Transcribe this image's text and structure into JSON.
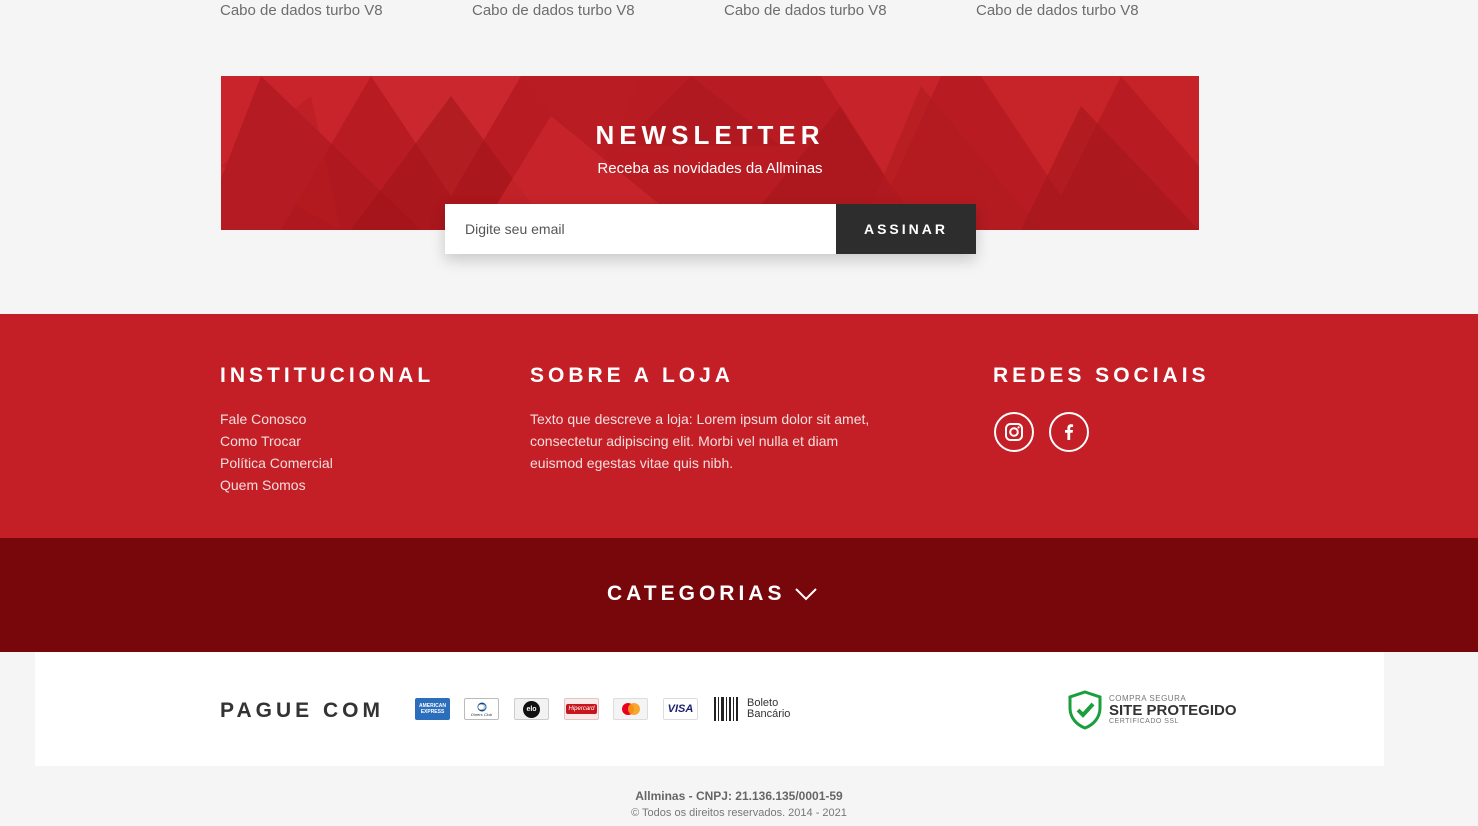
{
  "products": {
    "items": [
      {
        "name": "Cabo de dados turbo V8"
      },
      {
        "name": "Cabo de dados turbo V8"
      },
      {
        "name": "Cabo de dados turbo V8"
      },
      {
        "name": "Cabo de dados turbo V8"
      }
    ]
  },
  "newsletter": {
    "title": "NEWSLETTER",
    "subtitle": "Receba as novidades da Allminas",
    "placeholder": "Digite seu email",
    "button_label": "ASSINAR"
  },
  "footer": {
    "institucional": {
      "title": "INSTITUCIONAL",
      "links": [
        "Fale Conosco",
        "Como Trocar",
        "Política Comercial",
        "Quem Somos"
      ]
    },
    "sobre": {
      "title": "SOBRE A LOJA",
      "text": "Texto que descreve a loja: Lorem ipsum dolor sit amet, consectetur adipiscing elit. Morbi vel nulla et diam euismod egestas vitae quis nibh."
    },
    "redes": {
      "title": "REDES SOCIAIS",
      "icons": [
        "instagram-icon",
        "facebook-icon"
      ]
    }
  },
  "categories": {
    "label": "CATEGORIAS",
    "icon": "chevron-down-icon"
  },
  "payment": {
    "title": "PAGUE COM",
    "cards": [
      {
        "name": "amex-card-icon",
        "label": "AMERICAN EXPRESS"
      },
      {
        "name": "diners-club-card-icon",
        "label": "Diners Club"
      },
      {
        "name": "elo-card-icon",
        "label": "elo"
      },
      {
        "name": "hipercard-card-icon",
        "label": "Hipercard"
      },
      {
        "name": "mastercard-card-icon",
        "label": ""
      },
      {
        "name": "visa-card-icon",
        "label": "VISA"
      }
    ],
    "boleto_line1": "Boleto",
    "boleto_line2": "Bancário",
    "ssl": {
      "top": "COMPRA SEGURA",
      "main": "SITE PROTEGIDO",
      "bottom": "CERTIFICADO SSL"
    }
  },
  "legal": {
    "company": "Allminas - CNPJ: 21.136.135/0001-59",
    "copyright": "© Todos os direitos reservados. 2014 - 2021"
  },
  "colors": {
    "brand_red": "#c41f26",
    "dark_red": "#77070b",
    "button_dark": "#2d2d2d"
  }
}
